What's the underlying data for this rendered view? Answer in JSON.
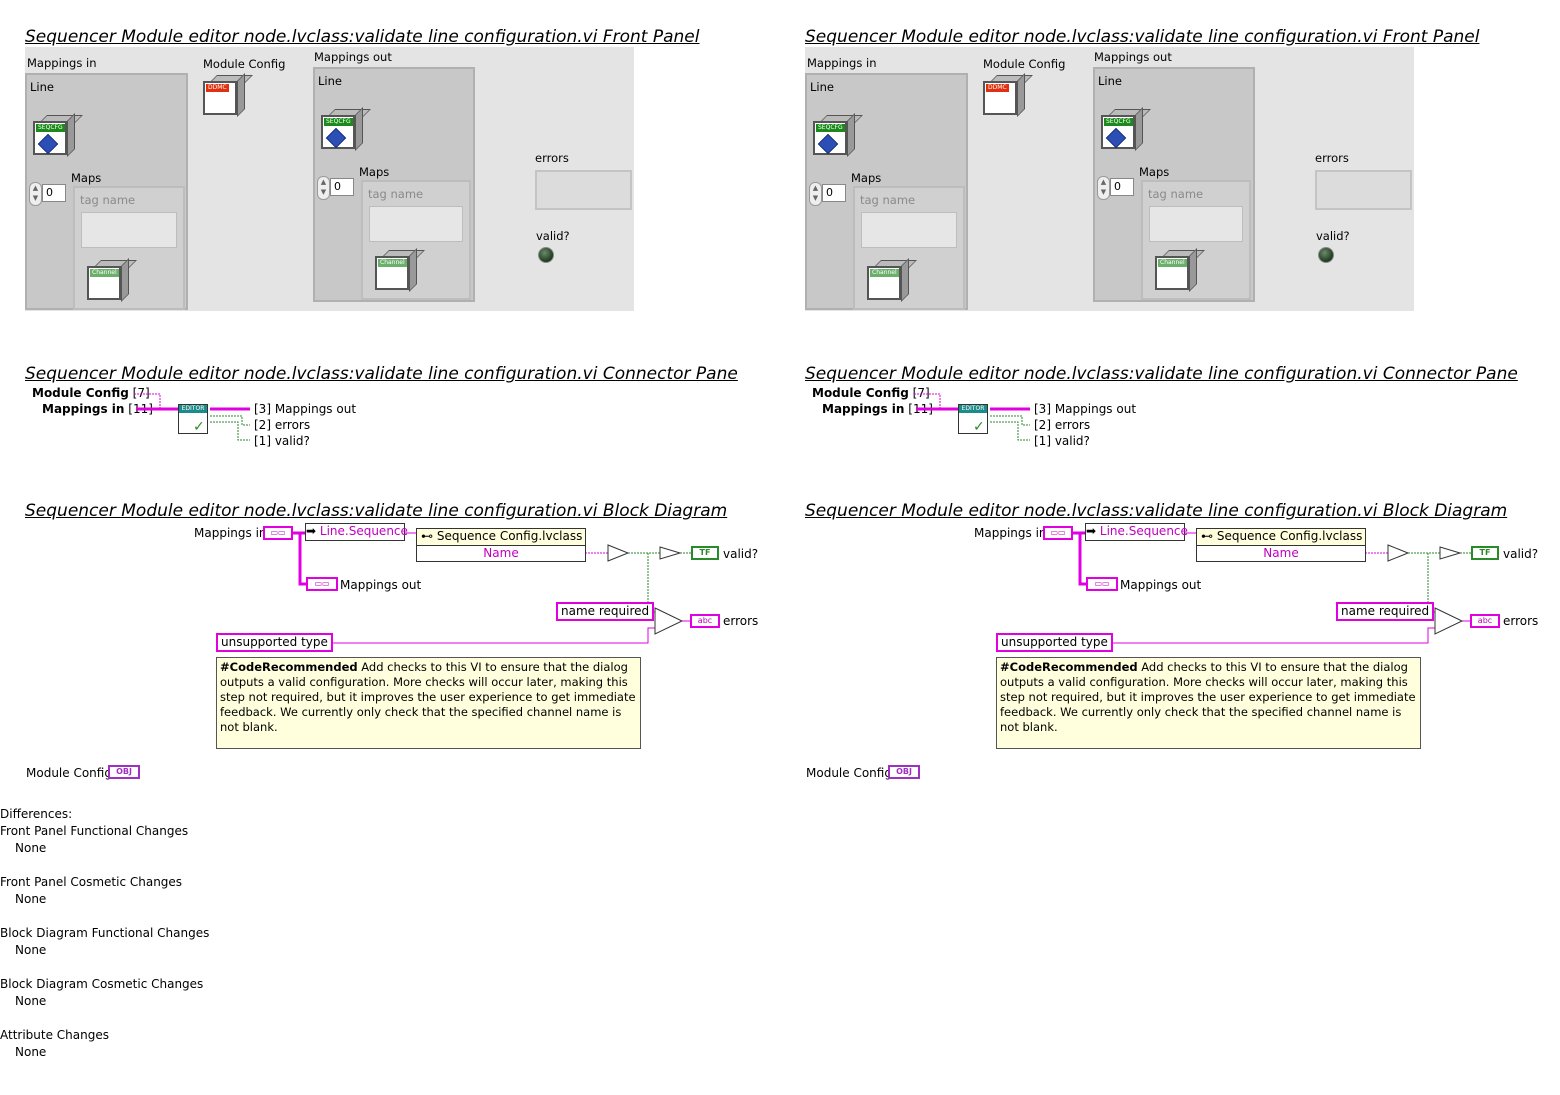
{
  "panels": [
    {
      "fp_title": "Sequencer Module editor node.lvclass:validate line configuration.vi Front Panel",
      "mappings_in": "Mappings in",
      "line": "Line",
      "maps": "Maps",
      "maps_index": "0",
      "tag_name": "tag name",
      "module_config": "Module Config",
      "mappings_out": "Mappings out",
      "line_out": "Line",
      "maps_out": "Maps",
      "maps_out_index": "0",
      "tag_name_out": "tag name",
      "errors": "errors",
      "valid": "valid?",
      "seqcfg_tag": "SEQCFG",
      "ddmc_tag": "DDMC",
      "channel_tag": "Channel",
      "cp_title": "Sequencer Module editor node.lvclass:validate line configuration.vi Connector Pane",
      "cp_module_config": "Module Config",
      "cp_module_config_idx": "[7]",
      "cp_mappings_in": "Mappings in",
      "cp_mappings_in_idx": "[11]",
      "cp_mappings_out": "[3] Mappings out",
      "cp_errors": "[2] errors",
      "cp_valid": "[1] valid?",
      "cp_icon_label": "EDITOR",
      "bd_title": "Sequencer Module editor node.lvclass:validate line configuration.vi Block Diagram",
      "bd_mappings_in": "Mappings in",
      "bd_line_sequence": "Line.Sequence",
      "bd_seq_config_class": "Sequence Config.lvclass",
      "bd_name": "Name",
      "bd_valid": "valid?",
      "bd_mappings_out": "Mappings out",
      "bd_name_required": "name required",
      "bd_errors": "errors",
      "bd_unsupported_type": "unsupported type",
      "bd_note_bold": "#CodeRecommended",
      "bd_note_text": " Add checks to this VI to ensure that the dialog outputs a valid configuration. More checks will occur later, making this step not required, but it improves the user experience to get immediate feedback.  We currently only check that the specified channel name is not blank.",
      "bd_module_config": "Module Config",
      "bd_obj": "OBJ",
      "bd_tf": "TF",
      "bd_abc": "abc"
    },
    {
      "fp_title": "Sequencer Module editor node.lvclass:validate line configuration.vi Front Panel",
      "mappings_in": "Mappings in",
      "line": "Line",
      "maps": "Maps",
      "maps_index": "0",
      "tag_name": "tag name",
      "module_config": "Module Config",
      "mappings_out": "Mappings out",
      "line_out": "Line",
      "maps_out": "Maps",
      "maps_out_index": "0",
      "tag_name_out": "tag name",
      "errors": "errors",
      "valid": "valid?",
      "seqcfg_tag": "SEQCFG",
      "ddmc_tag": "DDMC",
      "channel_tag": "Channel",
      "cp_title": "Sequencer Module editor node.lvclass:validate line configuration.vi Connector Pane",
      "cp_module_config": "Module Config",
      "cp_module_config_idx": "[7]",
      "cp_mappings_in": "Mappings in",
      "cp_mappings_in_idx": "[11]",
      "cp_mappings_out": "[3] Mappings out",
      "cp_errors": "[2] errors",
      "cp_valid": "[1] valid?",
      "cp_icon_label": "EDITOR",
      "bd_title": "Sequencer Module editor node.lvclass:validate line configuration.vi Block Diagram",
      "bd_mappings_in": "Mappings in",
      "bd_line_sequence": "Line.Sequence",
      "bd_seq_config_class": "Sequence Config.lvclass",
      "bd_name": "Name",
      "bd_valid": "valid?",
      "bd_mappings_out": "Mappings out",
      "bd_name_required": "name required",
      "bd_errors": "errors",
      "bd_unsupported_type": "unsupported type",
      "bd_note_bold": "#CodeRecommended",
      "bd_note_text": " Add checks to this VI to ensure that the dialog outputs a valid configuration. More checks will occur later, making this step not required, but it improves the user experience to get immediate feedback.  We currently only check that the specified channel name is not blank.",
      "bd_module_config": "Module Config",
      "bd_obj": "OBJ",
      "bd_tf": "TF",
      "bd_abc": "abc"
    }
  ],
  "differences": {
    "title": "Differences:",
    "sections": [
      {
        "heading": "Front Panel Functional Changes",
        "value": "None"
      },
      {
        "heading": "Front Panel Cosmetic Changes",
        "value": "None"
      },
      {
        "heading": "Block Diagram Functional Changes",
        "value": "None"
      },
      {
        "heading": "Block Diagram Cosmetic Changes",
        "value": "None"
      },
      {
        "heading": "Attribute Changes",
        "value": "None"
      }
    ]
  },
  "colors": {
    "wire_pink": "#e000e0",
    "wire_green": "#2a8a2a",
    "seqcfg_green": "#1a8a1a",
    "ddmc_red": "#e03010",
    "channel_green": "#6ab06a",
    "note_yellow": "#ffffdd"
  }
}
